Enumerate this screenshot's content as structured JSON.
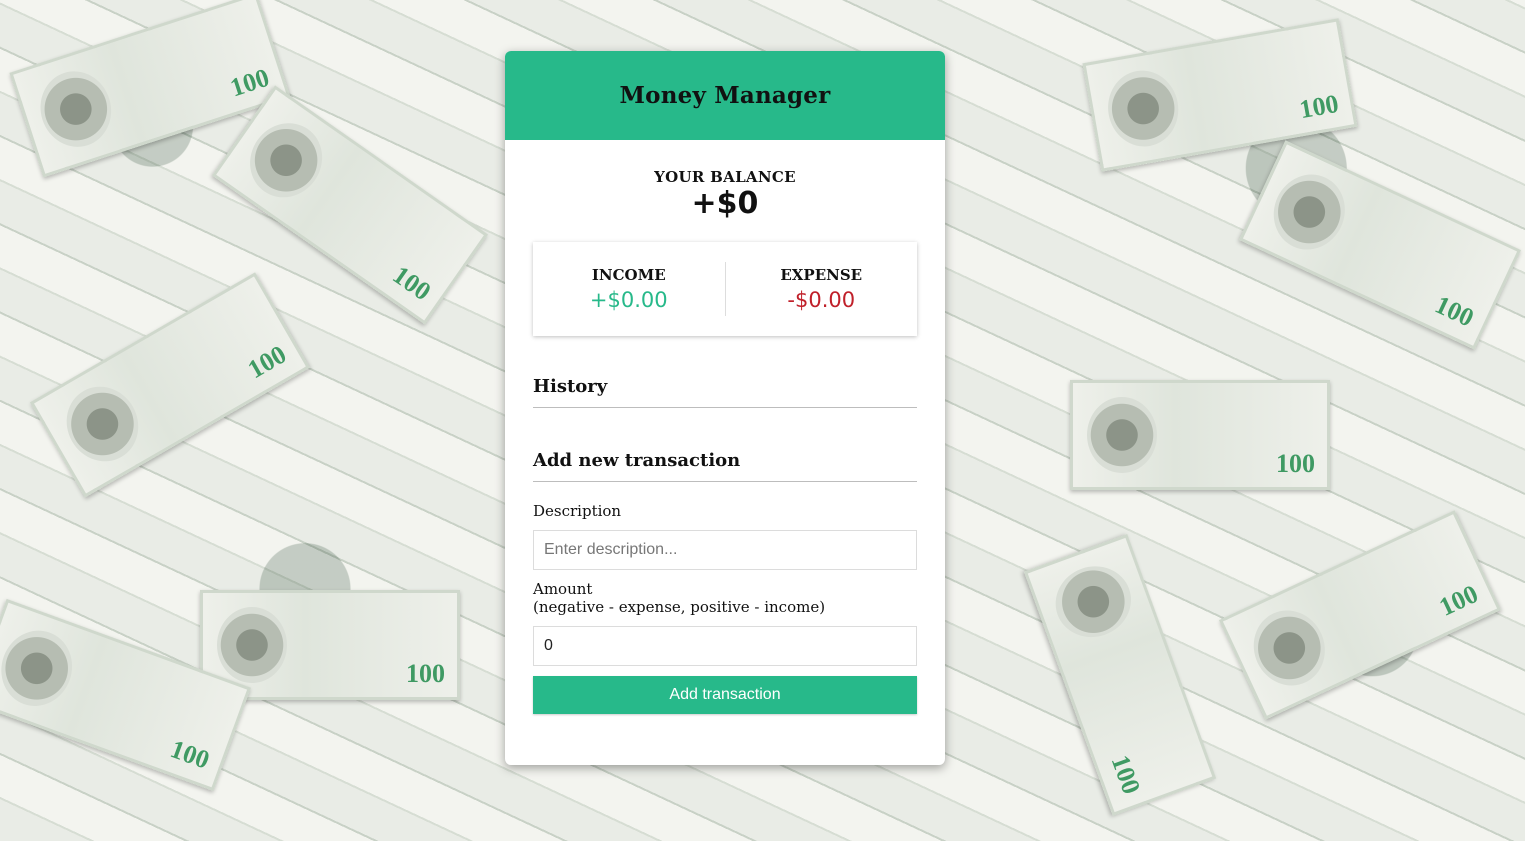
{
  "app": {
    "title": "Money Manager"
  },
  "balance": {
    "label": "YOUR BALANCE",
    "value": "+$0"
  },
  "income": {
    "label": "INCOME",
    "value": "+$0.00"
  },
  "expense": {
    "label": "EXPENSE",
    "value": "-$0.00"
  },
  "history": {
    "title": "History",
    "items": []
  },
  "add_transaction": {
    "title": "Add new transaction",
    "description_label": "Description",
    "description_placeholder": "Enter description...",
    "description_value": "",
    "amount_label": "Amount",
    "amount_hint": "(negative - expense, positive - income)",
    "amount_value": "0",
    "submit_label": "Add transaction"
  },
  "colors": {
    "accent": "#27b98a",
    "income": "#27b98a",
    "expense": "#c0202a"
  },
  "background": {
    "description": ""
  }
}
